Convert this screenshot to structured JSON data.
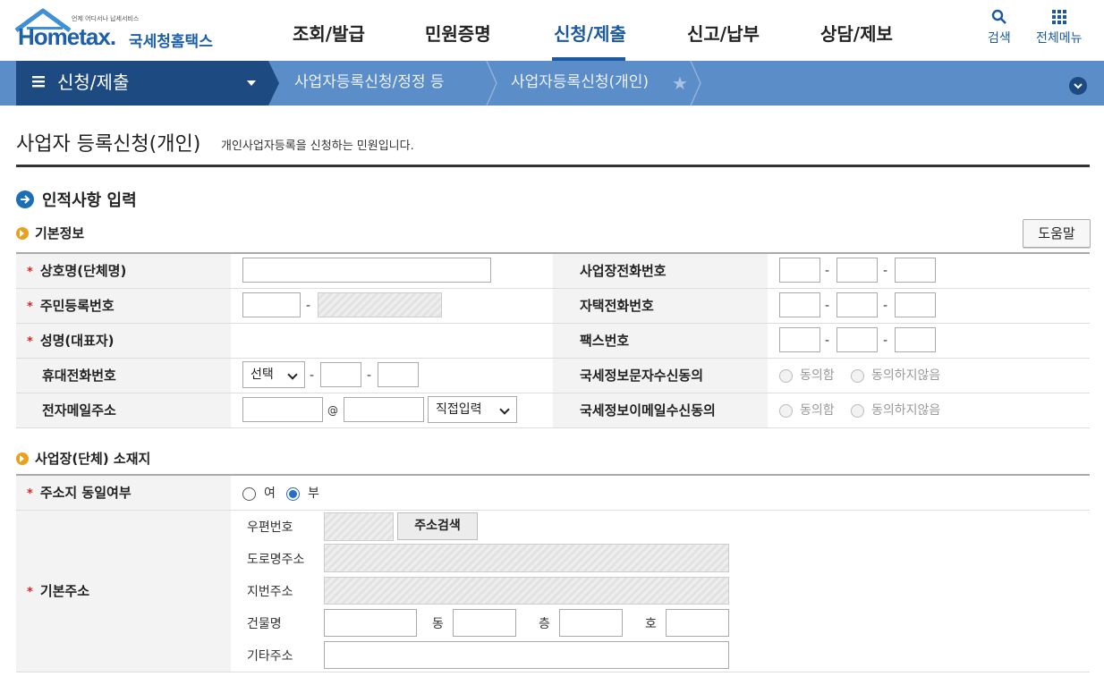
{
  "logo": {
    "tagline": "언제 어디서나 납세서비스",
    "main": "Hometax.",
    "sub": "국세청홈택스"
  },
  "nav": [
    "조회/발급",
    "민원증명",
    "신청/제출",
    "신고/납부",
    "상담/제보"
  ],
  "util": {
    "search": "검색",
    "menu": "전체메뉴"
  },
  "breadcrumb": {
    "home": "신청/제출",
    "level1": "사업자등록신청/정정 등",
    "level2": "사업자등록신청(개인)"
  },
  "page": {
    "title": "사업자 등록신청(개인)",
    "desc": "개인사업자등록을 신청하는 민원입니다."
  },
  "section": {
    "title": "인적사항 입력"
  },
  "basic": {
    "title": "기본정보",
    "help": "도움말",
    "rows": [
      {
        "label": "상호명(단체명)",
        "right": "사업장전화번호"
      },
      {
        "label": "주민등록번호",
        "right": "자택전화번호"
      },
      {
        "label": "성명(대표자)",
        "right": "팩스번호"
      },
      {
        "label": "휴대전화번호",
        "right": "국세정보문자수신동의"
      },
      {
        "label": "전자메일주소",
        "right": "국세정보이메일수신동의"
      }
    ],
    "phone_select": "선택",
    "at": "@",
    "email_select": "직접입력",
    "agree": "동의함",
    "disagree": "동의하지않음"
  },
  "address": {
    "title": "사업장(단체) 소재지",
    "same_label": "주소지 동일여부",
    "yes": "여",
    "no": "부",
    "base_label": "기본주소",
    "zip": "우편번호",
    "search_btn": "주소검색",
    "road": "도로명주소",
    "lot": "지번주소",
    "building": "건물명",
    "dong": "동",
    "floor": "층",
    "ho": "호",
    "etc": "기타주소"
  },
  "colors": {
    "brand": "#1b5aa0",
    "bar": "#5b8dc8",
    "bar_dark": "#1e4a82",
    "required": "#dd2222"
  }
}
